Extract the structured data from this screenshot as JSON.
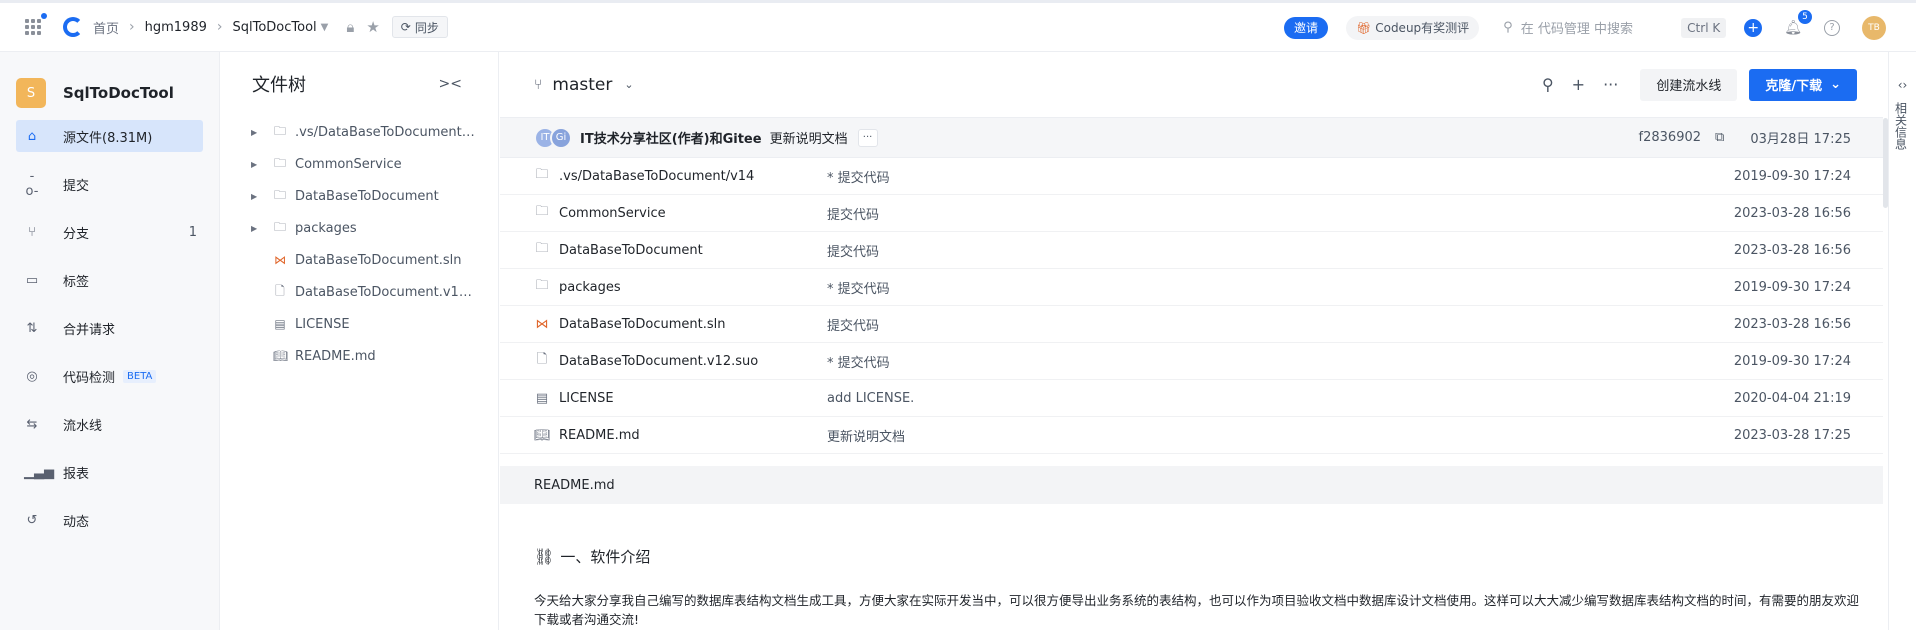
{
  "topbar": {
    "crumbs": [
      "首页",
      "hgm1989",
      "SqlToDocTool"
    ],
    "sync_label": "同步",
    "invite_label": "邀请",
    "codeup_label": "Codeup有奖测评",
    "search_placeholder": "在 代码管理 中搜索",
    "shortcut": "Ctrl K",
    "notif_count": "5",
    "avatar_initials": "TB"
  },
  "sidebar": {
    "project_initial": "S",
    "project_name": "SqlToDocTool",
    "items": [
      {
        "label": "源文件(8.31M)",
        "icon": "code-icon"
      },
      {
        "label": "提交",
        "icon": "commit-icon"
      },
      {
        "label": "分支",
        "icon": "branch-icon",
        "count": "1"
      },
      {
        "label": "标签",
        "icon": "tag-icon"
      },
      {
        "label": "合并请求",
        "icon": "merge-request-icon"
      },
      {
        "label": "代码检测",
        "icon": "scan-icon",
        "badge": "BETA"
      },
      {
        "label": "流水线",
        "icon": "pipeline-icon"
      },
      {
        "label": "报表",
        "icon": "report-icon"
      },
      {
        "label": "动态",
        "icon": "history-icon"
      }
    ]
  },
  "tree": {
    "title": "文件树",
    "items": [
      {
        "name": ".vs/DataBaseToDocument/v...",
        "type": "folder"
      },
      {
        "name": "CommonService",
        "type": "folder"
      },
      {
        "name": "DataBaseToDocument",
        "type": "folder"
      },
      {
        "name": "packages",
        "type": "folder"
      },
      {
        "name": "DataBaseToDocument.sln",
        "type": "vs"
      },
      {
        "name": "DataBaseToDocument.v12.s...",
        "type": "file"
      },
      {
        "name": "LICENSE",
        "type": "license"
      },
      {
        "name": "README.md",
        "type": "book"
      }
    ]
  },
  "main": {
    "branch": "master",
    "create_pipeline": "创建流水线",
    "clone_download": "克隆/下载",
    "commit": {
      "avatar1": "IT",
      "avatar2": "Gi",
      "author": "IT技术分享社区(作者)和Gitee",
      "message": "更新说明文档",
      "hash": "f2836902",
      "date": "03月28日 17:25"
    },
    "files": [
      {
        "name": ".vs/DataBaseToDocument/v14",
        "msg": "* 提交代码",
        "date": "2019-09-30 17:24",
        "type": "folder"
      },
      {
        "name": "CommonService",
        "msg": "提交代码",
        "date": "2023-03-28 16:56",
        "type": "folder"
      },
      {
        "name": "DataBaseToDocument",
        "msg": "提交代码",
        "date": "2023-03-28 16:56",
        "type": "folder"
      },
      {
        "name": "packages",
        "msg": "* 提交代码",
        "date": "2019-09-30 17:24",
        "type": "folder"
      },
      {
        "name": "DataBaseToDocument.sln",
        "msg": "提交代码",
        "date": "2023-03-28 16:56",
        "type": "vs"
      },
      {
        "name": "DataBaseToDocument.v12.suo",
        "msg": "* 提交代码",
        "date": "2019-09-30 17:24",
        "type": "file"
      },
      {
        "name": "LICENSE",
        "msg": "add LICENSE.",
        "date": "2020-04-04 21:19",
        "type": "license"
      },
      {
        "name": "README.md",
        "msg": "更新说明文档",
        "date": "2023-03-28 17:25",
        "type": "book"
      }
    ],
    "readme_title": "README.md",
    "readme_heading": "一、软件介绍",
    "readme_paragraph": "今天给大家分享我自己编写的数据库表结构文档生成工具，方便大家在实际开发当中，可以很方便导出业务系统的表结构，也可以作为项目验收文档中数据库设计文档使用。这样可以大大减少编写数据库表结构文档的时间，有需要的朋友欢迎下载或者沟通交流!"
  },
  "rightrail": {
    "label": "相关信息"
  }
}
